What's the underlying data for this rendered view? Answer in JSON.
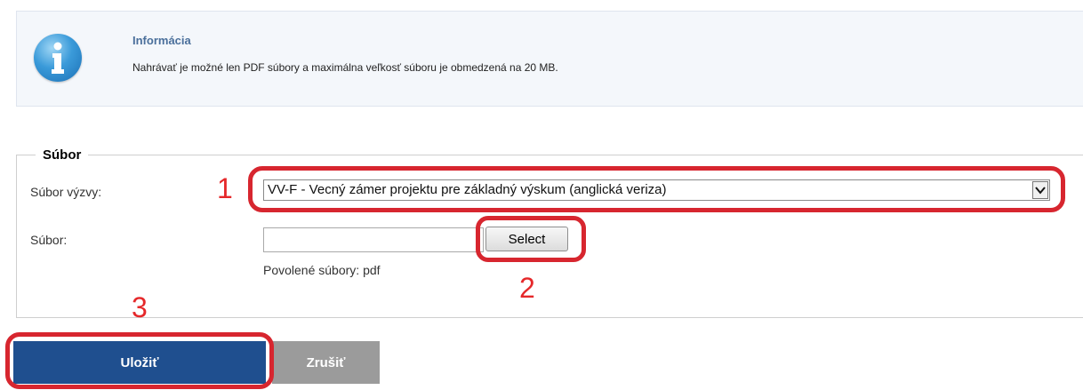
{
  "info": {
    "title": "Informácia",
    "message": "Nahrávať je možné len PDF súbory a maximálna veľkosť súboru je obmedzená na 20 MB."
  },
  "form": {
    "legend": "Súbor",
    "call_file_label": "Súbor výzvy:",
    "call_file_selected": "VV-F - Vecný zámer projektu pre základný výskum (anglická veriza)",
    "file_label": "Súbor:",
    "file_value": "",
    "select_button": "Select",
    "allowed_files": "Povolené súbory: pdf"
  },
  "actions": {
    "save_label": "Uložiť",
    "cancel_label": "Zrušiť"
  },
  "annotations": {
    "step1": "1",
    "step2": "2",
    "step3": "3",
    "color": "#e5282a"
  },
  "colors": {
    "primary": "#1f4f8f",
    "secondary": "#9b9b9b",
    "info_title": "#4a6f9b"
  }
}
